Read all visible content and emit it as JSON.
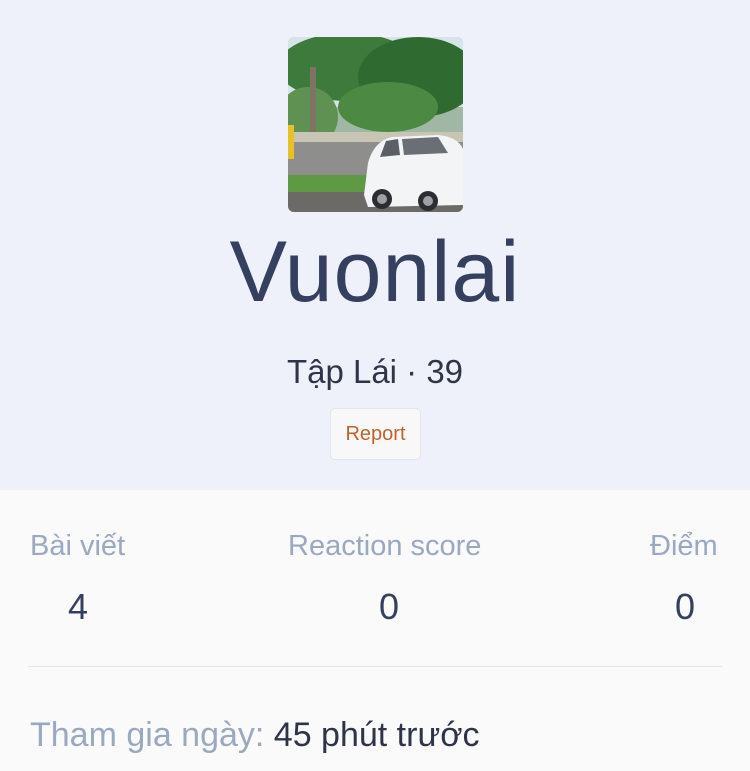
{
  "profile": {
    "username": "Vuonlai",
    "user_title": "Tập Lái · 39",
    "report_label": "Report",
    "avatar_icon": "avatar-photo"
  },
  "stats": {
    "messages": {
      "label": "Bài viết",
      "value": "4"
    },
    "reaction_score": {
      "label": "Reaction score",
      "value": "0"
    },
    "points": {
      "label": "Điểm",
      "value": "0"
    }
  },
  "joined": {
    "label": "Tham gia ngày:",
    "value": "45 phút trước"
  },
  "colors": {
    "header_bg": "#eef1f9",
    "username": "#34405e",
    "muted": "#9aa8c0",
    "report_text": "#c0622b"
  }
}
